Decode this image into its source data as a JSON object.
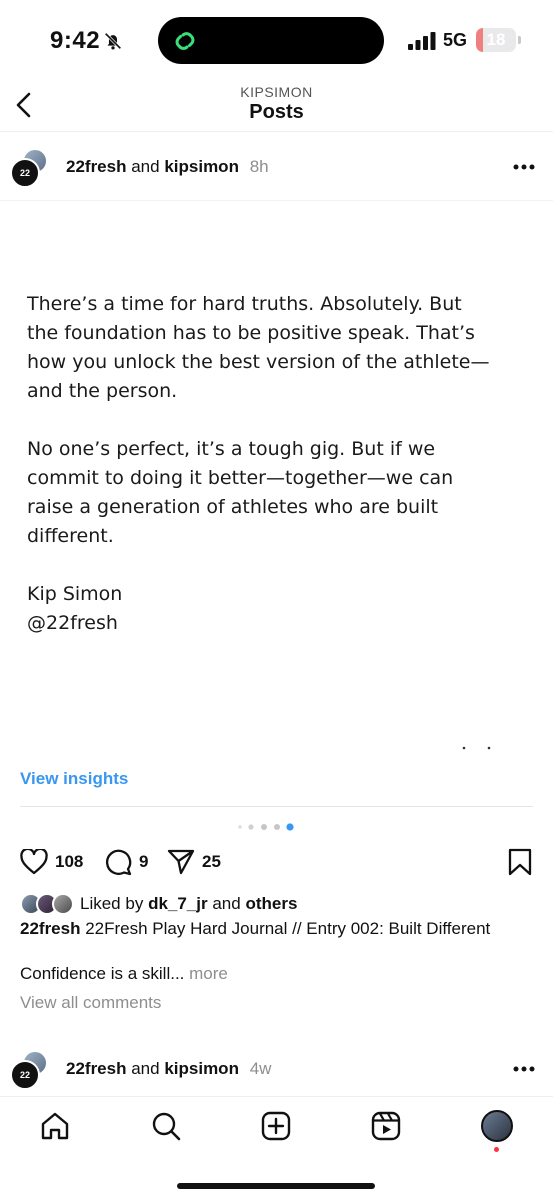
{
  "status_bar": {
    "time": "9:42",
    "network": "5G",
    "battery": "18",
    "battery_level_percent": 18,
    "silent_icon": "bell-slash-icon"
  },
  "header": {
    "username": "KIPSIMON",
    "title": "Posts",
    "back_icon": "chevron-left-icon"
  },
  "post": {
    "author_a": "22fresh",
    "connector": "and",
    "author_b": "kipsimon",
    "time": "8h",
    "avatar_text": "22",
    "paragraphs": [
      "There’s a time for hard truths. Absolutely. But\nthe foundation has to be positive speak. That’s\nhow you unlock the best version of the athlete—\nand the person.",
      "No one’s perfect,  it’s a tough gig. But if we\ncommit to doing it better—together—we can\nraise a generation of athletes who are built\ndifferent."
    ],
    "signature": "Kip Simon\n@22fresh",
    "view_insights": "View insights",
    "likes": "108",
    "comments": "9",
    "shares": "25",
    "liked_by_prefix": "Liked by",
    "liked_by_user": "dk_7_jr",
    "liked_by_and": "and",
    "liked_by_others": "others",
    "caption_user": "22fresh",
    "caption_text": " 22Fresh Play Hard Journal // Entry 002: Built Different",
    "caption_line2": "Confidence is a skill...",
    "more": "more",
    "view_all_comments": "View all comments"
  },
  "next_post": {
    "author_a": "22fresh",
    "connector": "and",
    "author_b": "kipsimon",
    "time": "4w",
    "avatar_text": "22"
  },
  "tabbar": {
    "icons": [
      "home-icon",
      "search-icon",
      "create-icon",
      "reels-icon",
      "profile-avatar"
    ]
  },
  "colors": {
    "link_blue": "#3897f0",
    "muted": "#8e8e8e",
    "notification_red": "#ff3040",
    "battery_low": "#f08080"
  }
}
